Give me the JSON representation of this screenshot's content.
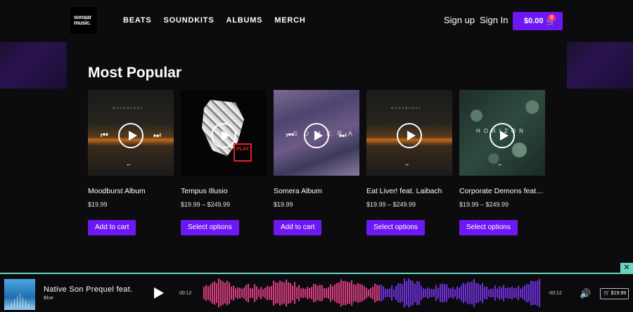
{
  "header": {
    "logo_line1": "sonaar",
    "logo_line2": "music.",
    "nav": [
      "BEATS",
      "SOUNDKITS",
      "ALBUMS",
      "MERCH"
    ],
    "sign_up": "Sign up",
    "sign_in": "Sign In",
    "cart_total": "$0.00",
    "cart_count": "0"
  },
  "section": {
    "title": "Most Popular"
  },
  "products": [
    {
      "title": "Moodburst Album",
      "price": "$19.99",
      "button": "Add to cart"
    },
    {
      "title": "Tempus Illusio",
      "price": "$19.99 – $249.99",
      "button": "Select options"
    },
    {
      "title": "Somera Album",
      "price": "$19.99",
      "button": "Add to cart"
    },
    {
      "title": "Eat Liver! feat. Laibach",
      "price": "$19.99 – $249.99",
      "button": "Select options"
    },
    {
      "title": "Corporate Demons feat. ...",
      "price": "$19.99 – $249.99",
      "button": "Select options"
    }
  ],
  "art_text": {
    "somera": "SOMERA",
    "horizon": "HORIZON",
    "play": "PLAY"
  },
  "player": {
    "track_title": "Native Son Prequel feat.",
    "artist": "Blue",
    "current_time": "00:12",
    "remaining_time": "-00:12",
    "buy_price": "$19.99",
    "close_glyph": "✕",
    "played_fraction": 0.52,
    "colors": {
      "played": "#d23c7c",
      "unplayed": "#6d2fd6",
      "accent": "#6d18f2",
      "border": "#6ad4c2"
    }
  }
}
